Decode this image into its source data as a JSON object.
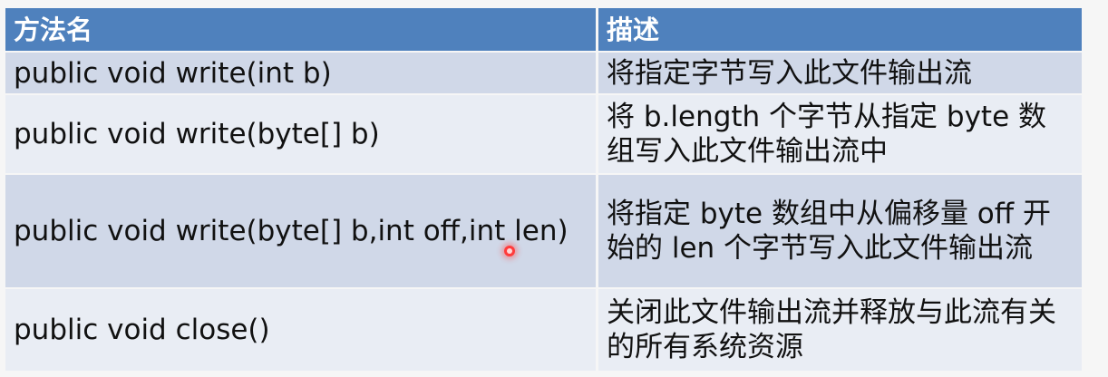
{
  "header": {
    "method_name": "方法名",
    "description": "描述"
  },
  "rows": [
    {
      "method": "public void write(int b)",
      "description": "将指定字节写入此文件输出流"
    },
    {
      "method": "public void write(byte[] b)",
      "description": "将 b.length 个字节从指定 byte 数组写入此文件输出流中"
    },
    {
      "method": "public void write(byte[] b,int off,int len)",
      "description": "将指定 byte 数组中从偏移量 off 开始的 len 个字节写入此文件输出流"
    },
    {
      "method": "public void close()",
      "description": "关闭此文件输出流并释放与此流有关的所有系统资源"
    }
  ],
  "colors": {
    "header_bg": "#4f81bd",
    "row_dark": "#d0d8e8",
    "row_light": "#e9edf4",
    "cursor": "#ff3b3b"
  },
  "icons": {
    "cursor": "mouse-pointer-icon"
  }
}
